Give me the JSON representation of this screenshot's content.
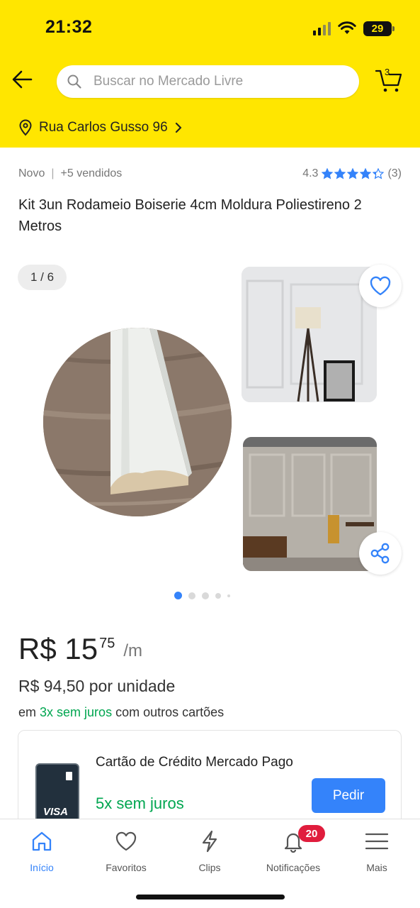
{
  "status_bar": {
    "time": "21:32",
    "battery": "29",
    "icons": [
      "signal-icon",
      "wifi-icon",
      "battery-icon"
    ]
  },
  "header": {
    "search_placeholder": "Buscar no Mercado Livre",
    "cart_count": "3",
    "address": "Rua Carlos Gusso 96",
    "background_color": "#ffe600"
  },
  "product": {
    "condition": "Novo",
    "sold": "+5 vendidos",
    "rating": "4.3",
    "rating_value": 4.3,
    "reviews": "(3)",
    "title": "Kit 3un Rodameio Boiserie 4cm Moldura Poliestireno 2 Metros",
    "gallery_counter": "1 / 6",
    "gallery_total": 6,
    "gallery_active_index": 0,
    "price_main": "R$ 15",
    "price_cents": "75",
    "price_unit": "/m",
    "price_per_unit": "R$ 94,50 por unidade",
    "installments_prefix": "em",
    "installments_highlight": "3x sem juros",
    "installments_suffix": "com outros cartões"
  },
  "credit_card_offer": {
    "card_label": "VISA",
    "title": "Cartão de Crédito Mercado Pago",
    "offer": "5x sem juros",
    "button": "Pedir"
  },
  "bottom_nav": {
    "items": [
      {
        "label": "Início",
        "icon": "home-icon",
        "active": true
      },
      {
        "label": "Favoritos",
        "icon": "heart-icon",
        "active": false
      },
      {
        "label": "Clips",
        "icon": "lightning-icon",
        "active": false
      },
      {
        "label": "Notificações",
        "icon": "bell-icon",
        "active": false,
        "badge": "20"
      },
      {
        "label": "Mais",
        "icon": "menu-icon",
        "active": false
      }
    ]
  },
  "colors": {
    "accent_blue": "#3483fa",
    "green": "#00a650",
    "badge_red": "#e01d3d",
    "star": "#3483fa"
  }
}
